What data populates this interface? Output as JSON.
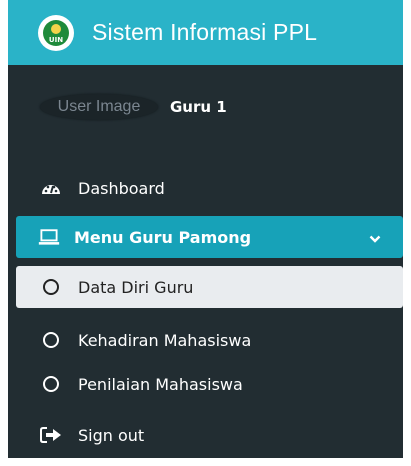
{
  "header": {
    "logo_text": "UIN",
    "title": "Sistem Informasi PPL"
  },
  "user": {
    "image_alt": "User Image",
    "name": "Guru 1"
  },
  "menu": {
    "dashboard": {
      "label": "Dashboard",
      "icon": "dashboard-gauge-icon"
    },
    "menu_guru_pamong": {
      "label": "Menu Guru Pamong",
      "icon": "laptop-icon",
      "expanded": true
    },
    "submenu": [
      {
        "label": "Data Diri Guru",
        "icon": "circle-icon",
        "active": true
      },
      {
        "label": "Kehadiran Mahasiswa",
        "icon": "circle-icon",
        "active": false
      },
      {
        "label": "Penilaian Mahasiswa",
        "icon": "circle-icon",
        "active": false
      }
    ],
    "signout": {
      "label": "Sign out",
      "icon": "sign-out-icon"
    }
  },
  "colors": {
    "sidebar_bg": "#222d32",
    "header_bg": "#2ab3c8",
    "active_bg": "#17a2b8",
    "selected_bg": "#e9ecef"
  }
}
